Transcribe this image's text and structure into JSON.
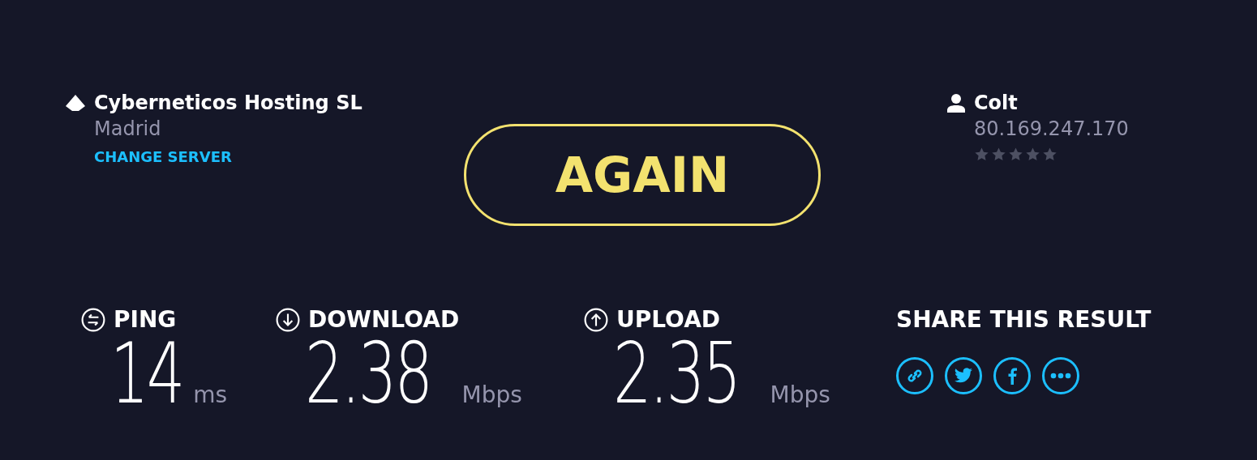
{
  "server": {
    "name": "Cyberneticos Hosting SL",
    "location": "Madrid",
    "link": "CHANGE SERVER"
  },
  "again_button": "AGAIN",
  "provider": {
    "name": "Colt",
    "ip": "80.169.247.170",
    "stars": 0
  },
  "metrics": [
    {
      "kind": "ping",
      "label": "PING",
      "value": "14",
      "unit": "ms"
    },
    {
      "kind": "download",
      "label": "DOWNLOAD",
      "value": "2.38",
      "unit": "Mbps"
    },
    {
      "kind": "upload",
      "label": "UPLOAD",
      "value": "2.35",
      "unit": "Mbps"
    }
  ],
  "share": {
    "title": "SHARE THIS RESULT",
    "buttons": [
      {
        "kind": "link"
      },
      {
        "kind": "twitter"
      },
      {
        "kind": "facebook"
      },
      {
        "kind": "more"
      }
    ]
  }
}
